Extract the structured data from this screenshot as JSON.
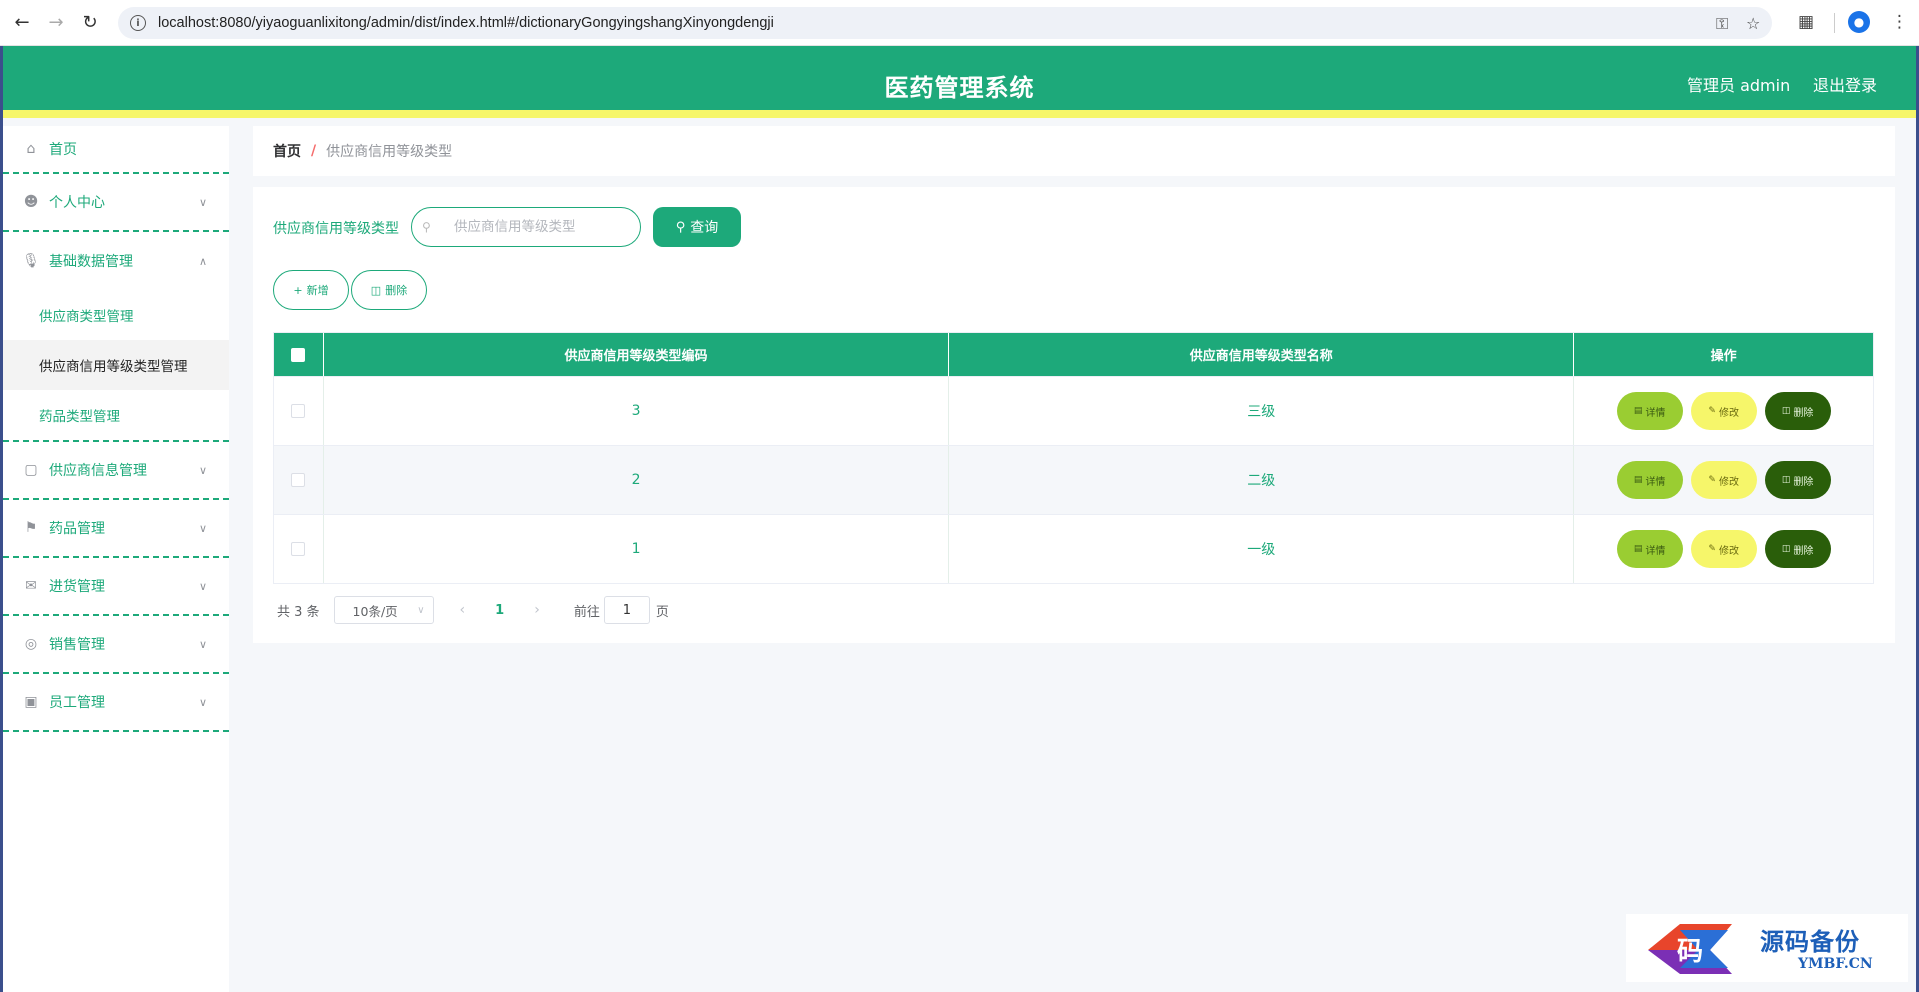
{
  "browser": {
    "url": "localhost:8080/yiyaoguanlixitong/admin/dist/index.html#/dictionaryGongyingshangXinyongdengji"
  },
  "header": {
    "title": "医药管理系统",
    "admin_label": "管理员 admin",
    "logout_label": "退出登录"
  },
  "sidebar": {
    "home": "首页",
    "items": [
      {
        "label": "个人中心",
        "icon": "user-icon"
      },
      {
        "label": "基础数据管理",
        "icon": "microphone-icon",
        "expanded": true,
        "children": [
          "供应商类型管理",
          "供应商信用等级类型管理",
          "药品类型管理"
        ],
        "active_child": 1
      },
      {
        "label": "供应商信息管理",
        "icon": "briefcase-icon"
      },
      {
        "label": "药品管理",
        "icon": "flag-icon"
      },
      {
        "label": "进货管理",
        "icon": "mail-icon"
      },
      {
        "label": "销售管理",
        "icon": "lifebuoy-icon"
      },
      {
        "label": "员工管理",
        "icon": "suitcase-icon"
      }
    ]
  },
  "breadcrumb": {
    "home": "首页",
    "current": "供应商信用等级类型"
  },
  "search": {
    "label": "供应商信用等级类型",
    "placeholder": "供应商信用等级类型",
    "button": "查询"
  },
  "actions": {
    "add": "新增",
    "delete": "删除"
  },
  "table": {
    "columns": [
      "供应商信用等级类型编码",
      "供应商信用等级类型名称",
      "操作"
    ],
    "rows": [
      {
        "code": "3",
        "name": "三级"
      },
      {
        "code": "2",
        "name": "二级"
      },
      {
        "code": "1",
        "name": "一级"
      }
    ],
    "row_actions": {
      "detail": "详情",
      "edit": "修改",
      "delete": "删除"
    }
  },
  "pagination": {
    "total": "共 3 条",
    "page_size": "10条/页",
    "current_page": "1",
    "goto_label": "前往",
    "goto_value": "1",
    "goto_unit": "页"
  },
  "watermark": {
    "cn": "源码备份",
    "en": "YMBF.CN",
    "glyph": "码"
  },
  "colors": {
    "primary": "#1da97a",
    "accent_yellow": "#f6f66a",
    "detail_btn": "#9acd32",
    "delete_btn": "#2a5e0a"
  }
}
